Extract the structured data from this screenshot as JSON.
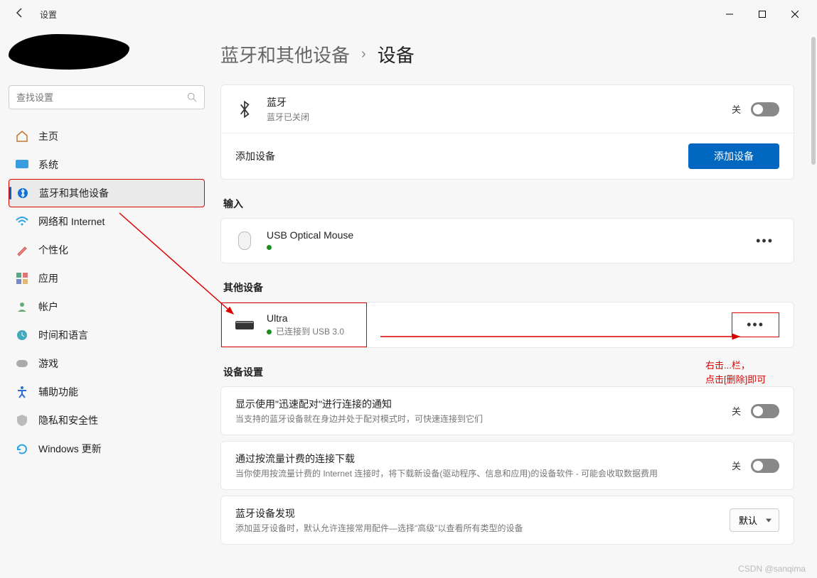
{
  "window": {
    "title": "设置"
  },
  "search": {
    "placeholder": "查找设置"
  },
  "nav": {
    "items": [
      {
        "label": "主页"
      },
      {
        "label": "系统"
      },
      {
        "label": "蓝牙和其他设备"
      },
      {
        "label": "网络和 Internet"
      },
      {
        "label": "个性化"
      },
      {
        "label": "应用"
      },
      {
        "label": "帐户"
      },
      {
        "label": "时间和语言"
      },
      {
        "label": "游戏"
      },
      {
        "label": "辅助功能"
      },
      {
        "label": "隐私和安全性"
      },
      {
        "label": "Windows 更新"
      }
    ]
  },
  "breadcrumb": {
    "parent": "蓝牙和其他设备",
    "current": "设备"
  },
  "bluetooth": {
    "title": "蓝牙",
    "subtitle": "蓝牙已关闭",
    "state_label": "关"
  },
  "add_device": {
    "label": "添加设备",
    "button": "添加设备"
  },
  "sections": {
    "input": {
      "title": "输入"
    },
    "other": {
      "title": "其他设备"
    },
    "settings": {
      "title": "设备设置"
    }
  },
  "devices": {
    "mouse": {
      "name": "USB Optical Mouse"
    },
    "ultra": {
      "name": "Ultra",
      "status": "已连接到 USB 3.0"
    }
  },
  "settings_rows": {
    "quickpair": {
      "title": "显示使用\"迅速配对\"进行连接的通知",
      "sub": "当支持的蓝牙设备就在身边并处于配对模式时，可快速连接到它们",
      "state": "关"
    },
    "metered": {
      "title": "通过按流量计费的连接下载",
      "sub": "当你使用按流量计费的 Internet 连接时，将下载新设备(驱动程序、信息和应用)的设备软件 - 可能会收取数据费用",
      "state": "关"
    },
    "discovery": {
      "title": "蓝牙设备发现",
      "sub": "添加蓝牙设备时，默认允许连接常用配件—选择\"高级\"以查看所有类型的设备",
      "select": "默认"
    }
  },
  "annotations": {
    "line1": "右击...栏，",
    "line2": "点击[删除]即可"
  },
  "watermark": "CSDN @sanqima"
}
